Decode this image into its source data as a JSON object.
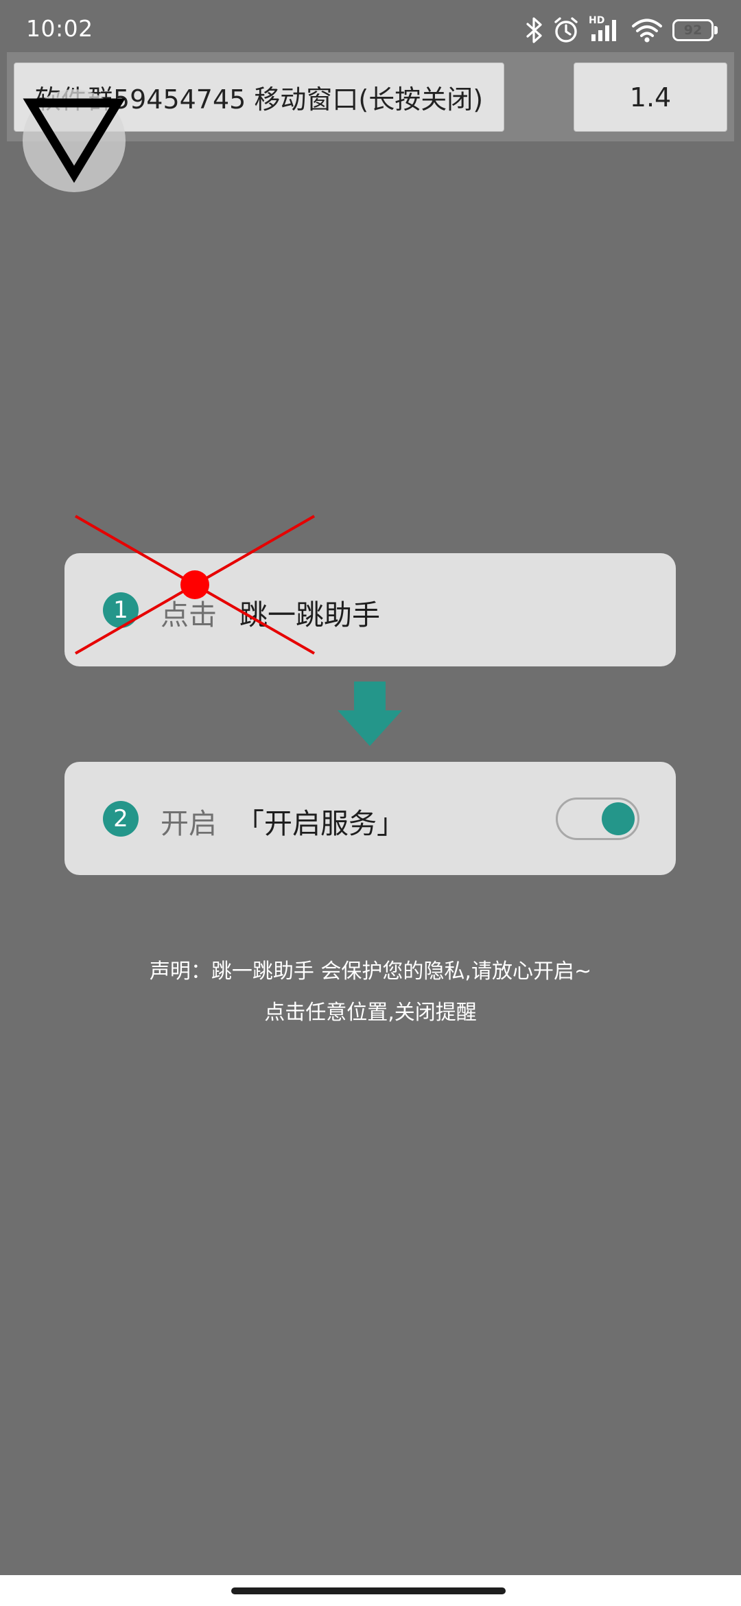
{
  "status_bar": {
    "time": "10:02",
    "battery": "92",
    "battery_level": 0.92,
    "network_badge": "HD",
    "icons": [
      "bluetooth-icon",
      "alarm-icon",
      "signal-icon",
      "wifi-icon",
      "battery-icon"
    ]
  },
  "floating_window": {
    "title": "软件群59454745  移动窗口(长按关闭)",
    "version": "1.4",
    "handle_icon": "triangle-down-icon"
  },
  "steps": [
    {
      "number": "1",
      "verb": "点击",
      "target": "跳一跳助手"
    },
    {
      "number": "2",
      "verb": "开启",
      "target": "「开启服务」",
      "toggle_on": true
    }
  ],
  "arrow_icon": "arrow-down-icon",
  "marker_icon": "red-cross-marker",
  "notice": {
    "line1": "声明：跳一跳助手 会保护您的隐私,请放心开启~",
    "line2": "点击任意位置,关闭提醒"
  },
  "colors": {
    "overlay": "#6f6f6f",
    "accent": "#24968a",
    "card": "#e0e0e0",
    "marker": "#e60000"
  }
}
